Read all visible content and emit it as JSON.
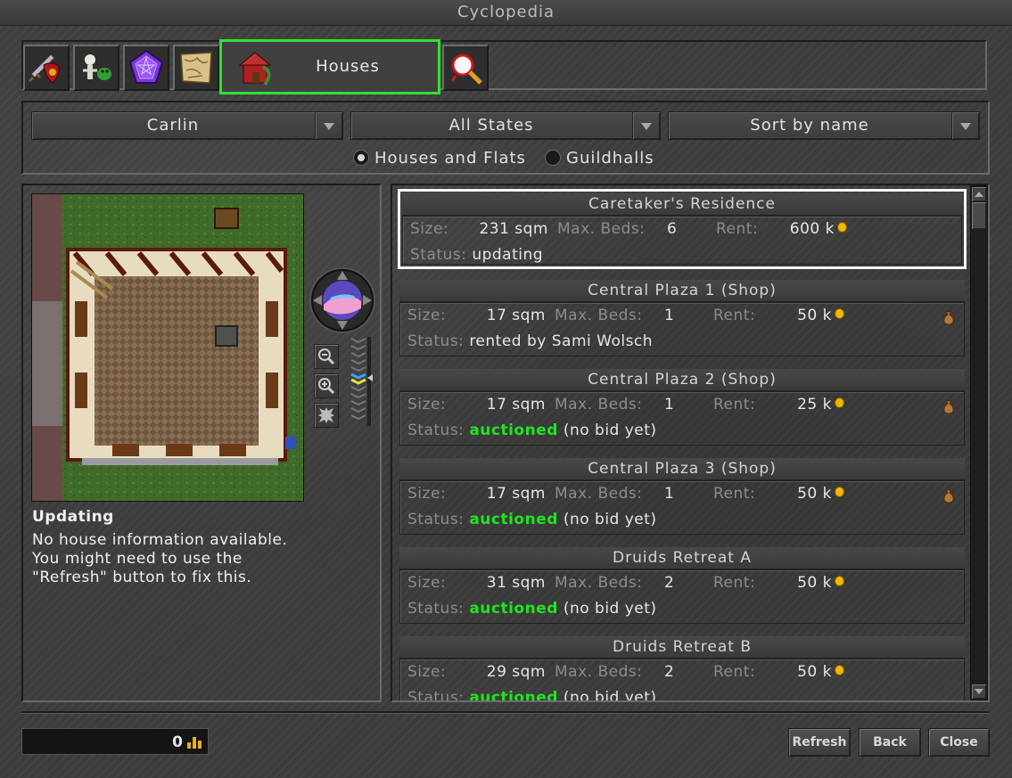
{
  "window": {
    "title": "Cyclopedia"
  },
  "tabs": [
    {
      "name": "items",
      "icon": "sword-shield-icon"
    },
    {
      "name": "creatures",
      "icon": "skeleton-monster-icon"
    },
    {
      "name": "spells",
      "icon": "purple-gem-icon"
    },
    {
      "name": "map",
      "icon": "parchment-map-icon"
    },
    {
      "name": "houses",
      "label": "Houses",
      "icon": "house-icon",
      "active": true
    },
    {
      "name": "search",
      "icon": "magnifier-icon"
    }
  ],
  "filters": {
    "town": "Carlin",
    "state": "All States",
    "sort": "Sort by name",
    "radio_houses": "Houses and Flats",
    "radio_guildhalls": "Guildhalls",
    "radio_selected": "houses"
  },
  "preview": {
    "title": "Updating",
    "body": "No house information available.\nYou might need to use the\n\"Refresh\" button to fix this."
  },
  "labels": {
    "size": "Size:",
    "beds": "Max. Beds:",
    "rent": "Rent:",
    "status": "Status:"
  },
  "houses": [
    {
      "name": "Caretaker's Residence",
      "size": "231 sqm",
      "beds": "6",
      "rent": "600 k",
      "status_hl": "",
      "status_rest": "updating",
      "bag": false,
      "selected": true
    },
    {
      "name": "Central Plaza 1 (Shop)",
      "size": "17 sqm",
      "beds": "1",
      "rent": "50 k",
      "status_hl": "",
      "status_rest": "rented by Sami Wolsch",
      "bag": true,
      "selected": false
    },
    {
      "name": "Central Plaza 2 (Shop)",
      "size": "17 sqm",
      "beds": "1",
      "rent": "25 k",
      "status_hl": "auctioned",
      "status_rest": "(no bid yet)",
      "bag": true,
      "selected": false
    },
    {
      "name": "Central Plaza 3 (Shop)",
      "size": "17 sqm",
      "beds": "1",
      "rent": "50 k",
      "status_hl": "auctioned",
      "status_rest": "(no bid yet)",
      "bag": true,
      "selected": false
    },
    {
      "name": "Druids Retreat A",
      "size": "31 sqm",
      "beds": "2",
      "rent": "50 k",
      "status_hl": "auctioned",
      "status_rest": "(no bid yet)",
      "bag": false,
      "selected": false
    },
    {
      "name": "Druids Retreat B",
      "size": "29 sqm",
      "beds": "2",
      "rent": "50 k",
      "status_hl": "auctioned",
      "status_rest": "(no bid yet)",
      "bag": false,
      "selected": false
    }
  ],
  "footer": {
    "gold": "0",
    "refresh": "Refresh",
    "back": "Back",
    "close": "Close"
  },
  "colors": {
    "accent_green": "#30e030",
    "status_green": "#1ee61e"
  }
}
